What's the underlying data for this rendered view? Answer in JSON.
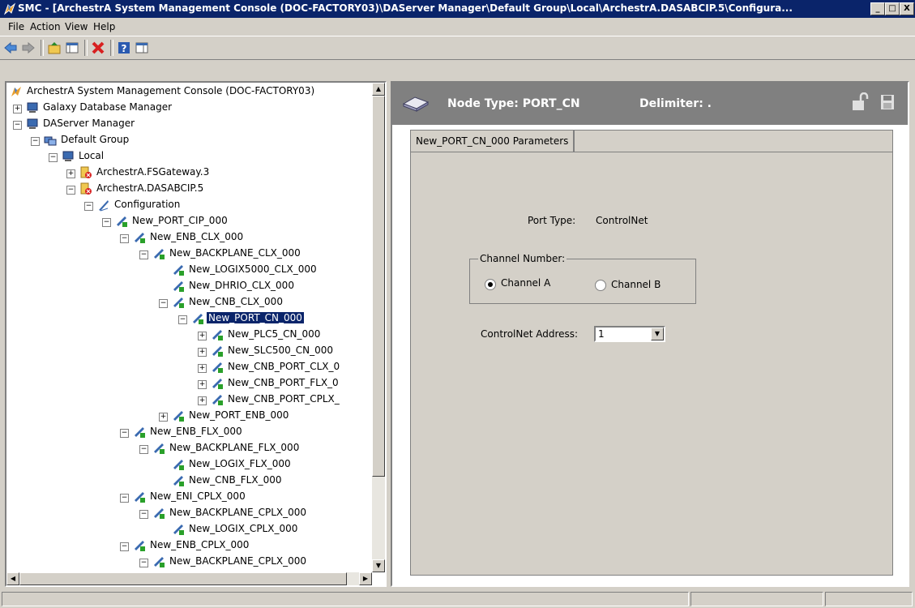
{
  "window": {
    "title": "SMC - [ArchestrA System Management Console (DOC-FACTORY03)\\DAServer Manager\\Default Group\\Local\\ArchestrA.DASABCIP.5\\Configura...",
    "minimize": "_",
    "maximize": "□",
    "close": "X"
  },
  "menu": {
    "file": "File",
    "action": "Action",
    "view": "View",
    "help": "Help"
  },
  "tree": {
    "items": [
      {
        "label": "ArchestrA System Management Console (DOC-FACTORY03)"
      },
      {
        "label": "Galaxy Database Manager"
      },
      {
        "label": "DAServer Manager"
      },
      {
        "label": "Default Group"
      },
      {
        "label": "Local"
      },
      {
        "label": "ArchestrA.FSGateway.3"
      },
      {
        "label": "ArchestrA.DASABCIP.5"
      },
      {
        "label": "Configuration"
      },
      {
        "label": "New_PORT_CIP_000"
      },
      {
        "label": "New_ENB_CLX_000"
      },
      {
        "label": "New_BACKPLANE_CLX_000"
      },
      {
        "label": "New_LOGIX5000_CLX_000"
      },
      {
        "label": "New_DHRIO_CLX_000"
      },
      {
        "label": "New_CNB_CLX_000"
      },
      {
        "label": "New_PORT_CN_000"
      },
      {
        "label": "New_PLC5_CN_000"
      },
      {
        "label": "New_SLC500_CN_000"
      },
      {
        "label": "New_CNB_PORT_CLX_0"
      },
      {
        "label": "New_CNB_PORT_FLX_0"
      },
      {
        "label": "New_CNB_PORT_CPLX_"
      },
      {
        "label": "New_PORT_ENB_000"
      },
      {
        "label": "New_ENB_FLX_000"
      },
      {
        "label": "New_BACKPLANE_FLX_000"
      },
      {
        "label": "New_LOGIX_FLX_000"
      },
      {
        "label": "New_CNB_FLX_000"
      },
      {
        "label": "New_ENI_CPLX_000"
      },
      {
        "label": "New_BACKPLANE_CPLX_000"
      },
      {
        "label": "New_LOGIX_CPLX_000"
      },
      {
        "label": "New_ENB_CPLX_000"
      },
      {
        "label": "New_BACKPLANE_CPLX_000"
      }
    ]
  },
  "details": {
    "node_type": "Node Type: PORT_CN",
    "delimiter": "Delimiter: .",
    "tab_label": "New_PORT_CN_000 Parameters",
    "port_type_label": "Port Type:",
    "port_type_value": "ControlNet",
    "channel_group_label": "Channel Number:",
    "channel_a": "Channel A",
    "channel_b": "Channel B",
    "channel_selected": "Channel A",
    "address_label": "ControlNet Address:",
    "address_value": "1"
  }
}
